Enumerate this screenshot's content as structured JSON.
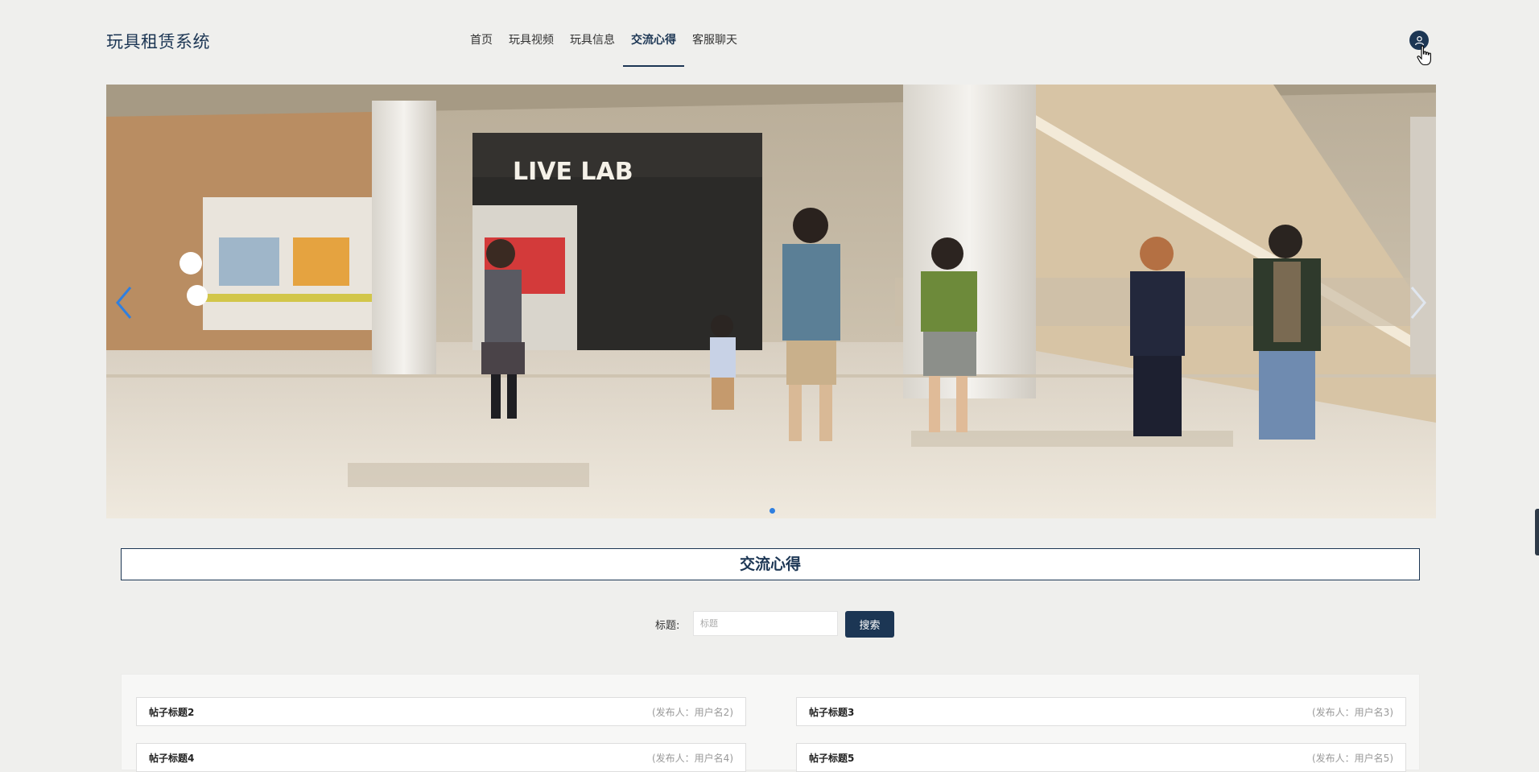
{
  "header": {
    "brand": "玩具租赁系统",
    "nav": [
      {
        "label": "首页"
      },
      {
        "label": "玩具视频"
      },
      {
        "label": "玩具信息"
      },
      {
        "label": "交流心得",
        "active": true
      },
      {
        "label": "客服聊天"
      }
    ],
    "user_icon": "user-icon"
  },
  "banner": {
    "sign_text": "LIVE LAB",
    "prev_icon": "chevron-left-icon",
    "next_icon": "chevron-right-icon",
    "slide_count": 1,
    "active_slide": 1
  },
  "section": {
    "title": "交流心得"
  },
  "search": {
    "label": "标题:",
    "placeholder": "标题",
    "value": "",
    "button_label": "搜索"
  },
  "posts": [
    {
      "title": "帖子标题2",
      "author": "(发布人：用户名2)"
    },
    {
      "title": "帖子标题3",
      "author": "(发布人：用户名3)"
    },
    {
      "title": "帖子标题4",
      "author": "(发布人：用户名4)"
    },
    {
      "title": "帖子标题5",
      "author": "(发布人：用户名5)"
    }
  ],
  "colors": {
    "primary": "#1c3654",
    "page_bg": "#efefed",
    "dot_active": "#2f7fe0"
  }
}
